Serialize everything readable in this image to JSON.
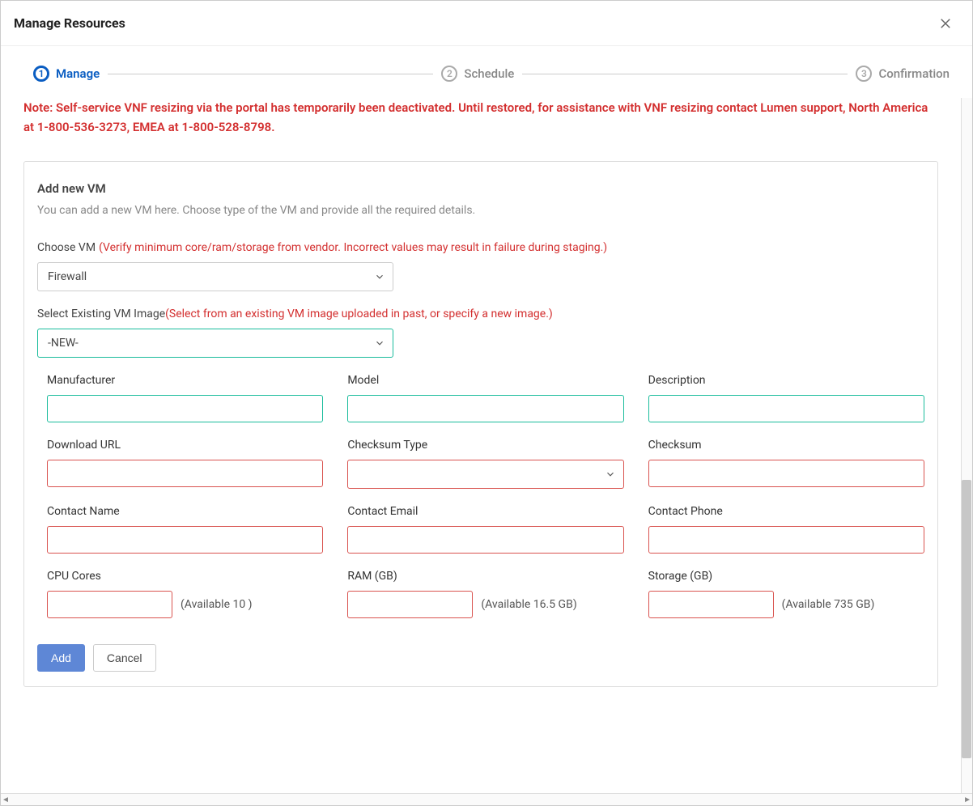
{
  "header": {
    "title": "Manage Resources"
  },
  "stepper": {
    "steps": [
      {
        "num": "1",
        "label": "Manage",
        "active": true
      },
      {
        "num": "2",
        "label": "Schedule",
        "active": false
      },
      {
        "num": "3",
        "label": "Confirmation",
        "active": false
      }
    ]
  },
  "note": "Note: Self-service VNF resizing via the portal has temporarily been deactivated. Until restored, for assistance with VNF resizing contact Lumen support, North America at 1-800-536-3273, EMEA at 1-800-528-8798.",
  "panel": {
    "title": "Add new VM",
    "desc": "You can add a new VM here. Choose type of the VM and provide all the required details.",
    "chooseVM": {
      "label": "Choose VM",
      "hint": "(Verify minimum core/ram/storage from vendor. Incorrect values may result in failure during staging.)",
      "value": "Firewall"
    },
    "selectImage": {
      "label": "Select Existing VM Image",
      "hint": "(Select from an existing VM image uploaded in past, or specify a new image.)",
      "value": "-NEW-"
    },
    "fields": {
      "manufacturer": {
        "label": "Manufacturer",
        "value": ""
      },
      "model": {
        "label": "Model",
        "value": ""
      },
      "description": {
        "label": "Description",
        "value": ""
      },
      "downloadURL": {
        "label": "Download URL",
        "value": ""
      },
      "checksumType": {
        "label": "Checksum Type",
        "value": ""
      },
      "checksum": {
        "label": "Checksum",
        "value": ""
      },
      "contactName": {
        "label": "Contact Name",
        "value": ""
      },
      "contactEmail": {
        "label": "Contact Email",
        "value": ""
      },
      "contactPhone": {
        "label": "Contact Phone",
        "value": ""
      },
      "cpuCores": {
        "label": "CPU Cores",
        "value": "",
        "available": "(Available 10 )"
      },
      "ram": {
        "label": "RAM (GB)",
        "value": "",
        "available": "(Available 16.5 GB)"
      },
      "storage": {
        "label": "Storage (GB)",
        "value": "",
        "available": "(Available 735 GB)"
      }
    },
    "actions": {
      "add": "Add",
      "cancel": "Cancel"
    }
  }
}
